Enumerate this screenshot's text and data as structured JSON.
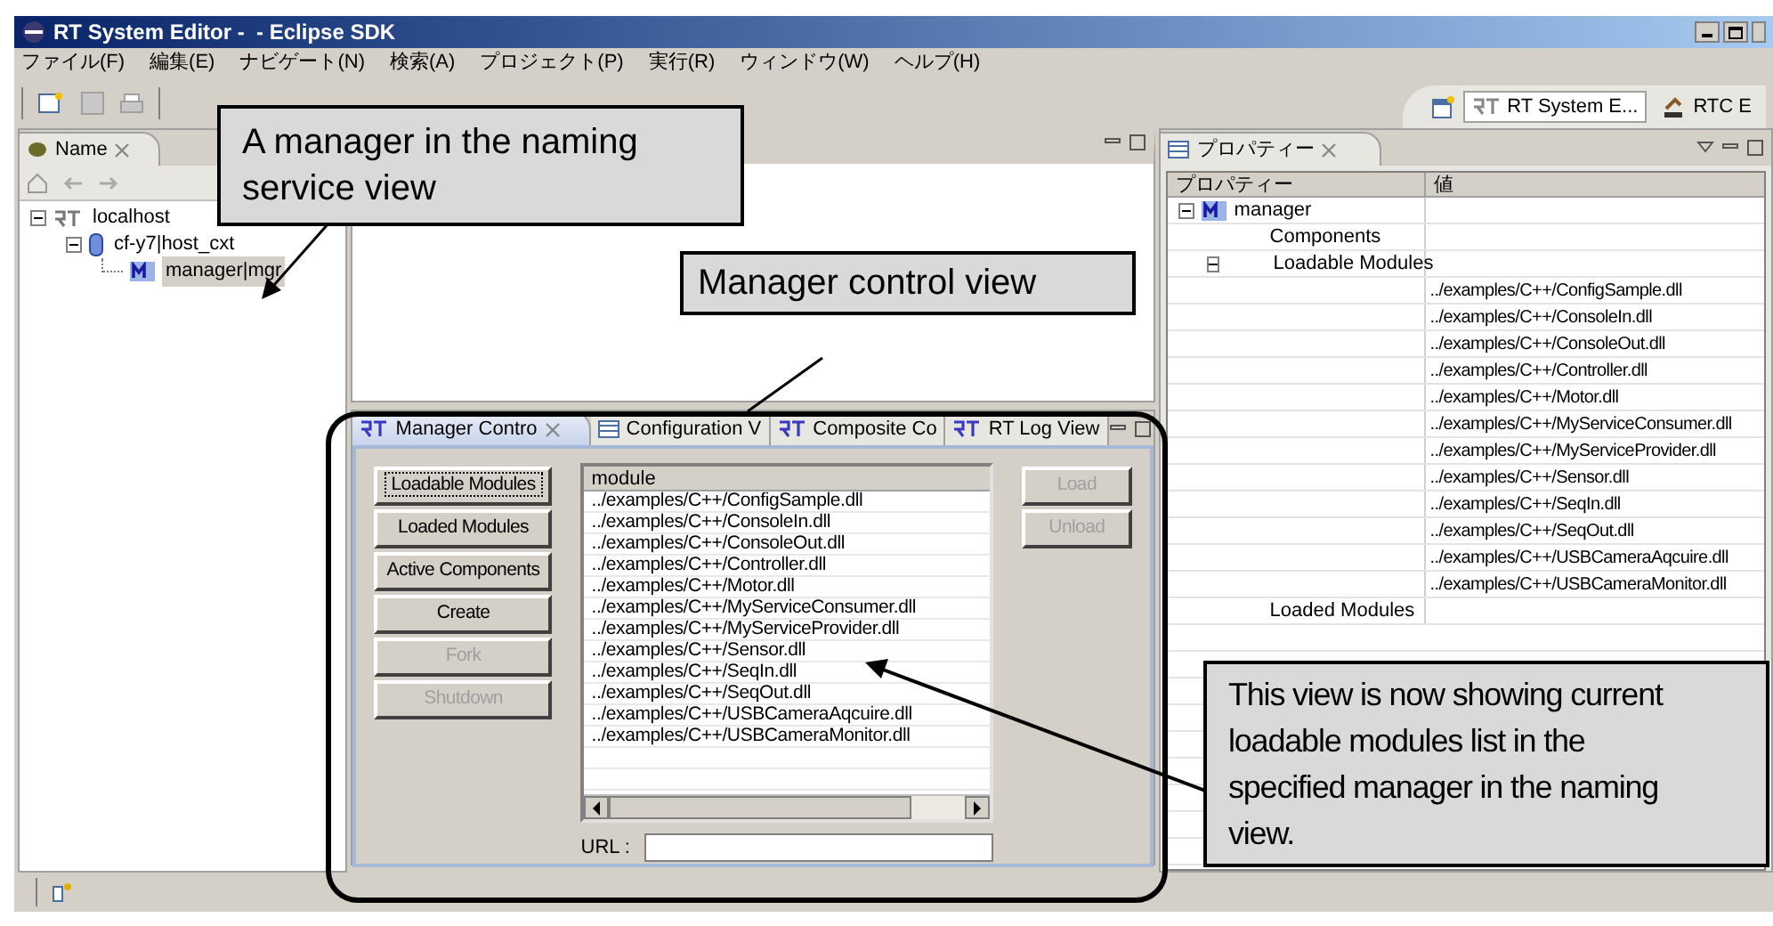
{
  "window": {
    "title": "RT System Editor -  - Eclipse SDK"
  },
  "menu": [
    "ファイル(F)",
    "編集(E)",
    "ナビゲート(N)",
    "検索(A)",
    "プロジェクト(P)",
    "実行(R)",
    "ウィンドウ(W)",
    "ヘルプ(H)"
  ],
  "perspectives": [
    {
      "label": "RT System E...",
      "selected": true
    },
    {
      "label": "RTC E",
      "selected": false
    }
  ],
  "naming_view": {
    "tab": "Name",
    "tree": [
      {
        "label": "localhost",
        "expanded": true,
        "children": [
          {
            "label": "cf-y7|host_cxt",
            "expanded": true,
            "children": [
              {
                "label": "manager|mgr",
                "selected": true
              }
            ]
          }
        ]
      }
    ]
  },
  "manager_control": {
    "tabs": [
      {
        "label": "Manager Contro",
        "selected": true
      },
      {
        "label": "Configuration V",
        "selected": false
      },
      {
        "label": "Composite Co",
        "selected": false
      },
      {
        "label": "RT Log View",
        "selected": false
      }
    ],
    "buttons": [
      {
        "label": "Loadable Modules",
        "disabled": false,
        "focused": true
      },
      {
        "label": "Loaded Modules",
        "disabled": false,
        "focused": false
      },
      {
        "label": "Active Components",
        "disabled": false,
        "focused": false
      },
      {
        "label": "Create",
        "disabled": false,
        "focused": false
      },
      {
        "label": "Fork",
        "disabled": true,
        "focused": false
      },
      {
        "label": "Shutdown",
        "disabled": true,
        "focused": false
      }
    ],
    "table": {
      "columns": [
        "module"
      ],
      "rows": [
        "../examples/C++/ConfigSample.dll",
        "../examples/C++/ConsoleIn.dll",
        "../examples/C++/ConsoleOut.dll",
        "../examples/C++/Controller.dll",
        "../examples/C++/Motor.dll",
        "../examples/C++/MyServiceConsumer.dll",
        "../examples/C++/MyServiceProvider.dll",
        "../examples/C++/Sensor.dll",
        "../examples/C++/SeqIn.dll",
        "../examples/C++/SeqOut.dll",
        "../examples/C++/USBCameraAqcuire.dll",
        "../examples/C++/USBCameraMonitor.dll"
      ]
    },
    "side_buttons": [
      {
        "label": "Load",
        "disabled": true
      },
      {
        "label": "Unload",
        "disabled": true
      }
    ],
    "url_label": "URL :"
  },
  "properties": {
    "tab": "プロパティー",
    "columns": [
      "プロパティー",
      "値"
    ],
    "tree": [
      {
        "label": "manager",
        "expanded": true,
        "children": [
          {
            "label": "Components"
          },
          {
            "label": "Loadable Modules",
            "expanded": true,
            "children": [
              {
                "value": "../examples/C++/ConfigSample.dll"
              },
              {
                "value": "../examples/C++/ConsoleIn.dll"
              },
              {
                "value": "../examples/C++/ConsoleOut.dll"
              },
              {
                "value": "../examples/C++/Controller.dll"
              },
              {
                "value": "../examples/C++/Motor.dll"
              },
              {
                "value": "../examples/C++/MyServiceConsumer.dll"
              },
              {
                "value": "../examples/C++/MyServiceProvider.dll"
              },
              {
                "value": "../examples/C++/Sensor.dll"
              },
              {
                "value": "../examples/C++/SeqIn.dll"
              },
              {
                "value": "../examples/C++/SeqOut.dll"
              },
              {
                "value": "../examples/C++/USBCameraAqcuire.dll"
              },
              {
                "value": "../examples/C++/USBCameraMonitor.dll"
              }
            ]
          },
          {
            "label": "Loaded Modules"
          }
        ]
      }
    ]
  },
  "callouts": [
    "A manager in the naming service view",
    "Manager control view",
    "This view is now showing current loadable modules list in the specified manager in the naming view."
  ]
}
